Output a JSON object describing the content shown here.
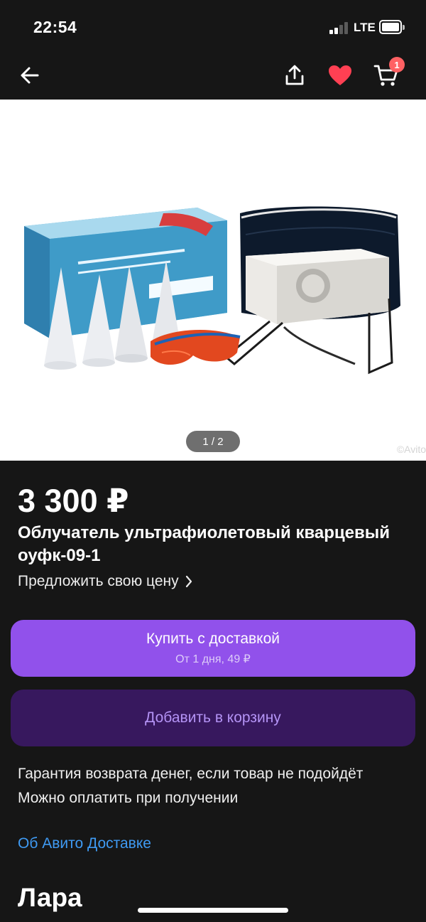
{
  "status_bar": {
    "time": "22:54",
    "network": "LTE",
    "signal_bars_active": 2,
    "signal_bars_total": 4,
    "battery_level": 0.85
  },
  "nav": {
    "back_icon": "arrow-left-icon",
    "share_icon": "share-upload-icon",
    "favorite_icon": "heart-icon",
    "favorite_color": "#ff4053",
    "cart_icon": "shopping-cart-icon",
    "cart_badge": "1",
    "cart_badge_color": "#ff6163"
  },
  "gallery": {
    "counter": "1 / 2",
    "watermark": "©Avito"
  },
  "product": {
    "price": "3 300 ₽",
    "title": "Облучатель ультрафиолетовый кварцевый оуфк-09-1",
    "offer_price": "Предложить свою цену"
  },
  "actions": {
    "buy_label": "Купить с доставкой",
    "buy_sub": "От 1 дня, 49 ₽",
    "buy_color": "#9151eb",
    "add_to_cart_label": "Добавить в корзину",
    "add_to_cart_color": "#37185e"
  },
  "info": {
    "guarantee": "Гарантия возврата денег, если товар не подойдёт",
    "payment": "Можно оплатить при получении",
    "delivery_link": "Об Авито Доставке",
    "link_color": "#3f9af3"
  },
  "seller": {
    "name": "Лара"
  }
}
